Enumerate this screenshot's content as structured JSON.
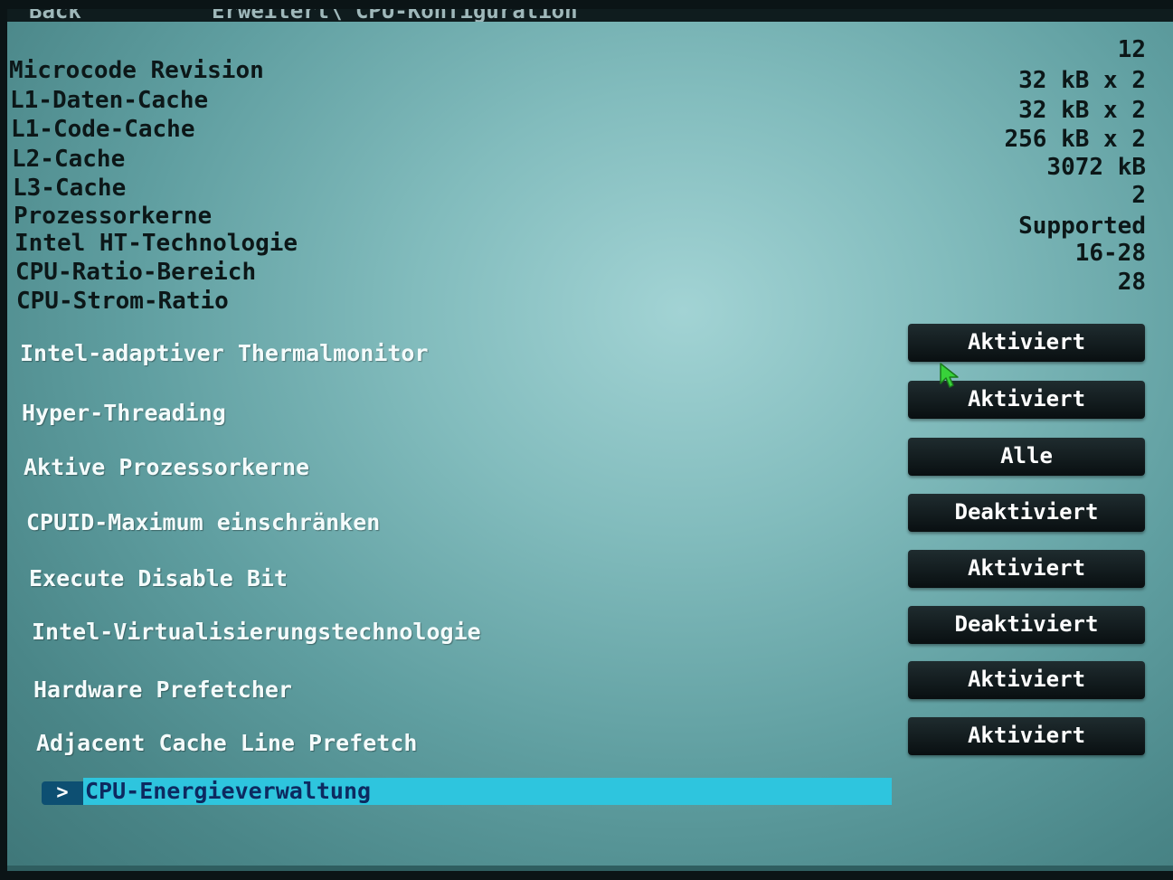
{
  "header": {
    "back_label": "Back",
    "breadcrumb": "Erweitert\\ CPU-Konfiguration"
  },
  "info": [
    {
      "label": "",
      "value": "12"
    },
    {
      "label": "Microcode Revision",
      "value": "32 kB x 2"
    },
    {
      "label": "L1-Daten-Cache",
      "value": "32 kB x 2"
    },
    {
      "label": "L1-Code-Cache",
      "value": "256 kB x 2"
    },
    {
      "label": "L2-Cache",
      "value": "3072 kB"
    },
    {
      "label": "L3-Cache",
      "value": "2"
    },
    {
      "label": "Prozessorkerne",
      "value": "Supported"
    },
    {
      "label": "Intel HT-Technologie",
      "value": "16-28"
    },
    {
      "label": "CPU-Ratio-Bereich",
      "value": "28"
    },
    {
      "label": "CPU-Strom-Ratio",
      "value": ""
    }
  ],
  "settings": [
    {
      "label": "Intel-adaptiver Thermalmonitor",
      "value": "Aktiviert"
    },
    {
      "label": "Hyper-Threading",
      "value": "Aktiviert"
    },
    {
      "label": "Aktive Prozessorkerne",
      "value": "Alle"
    },
    {
      "label": "CPUID-Maximum einschränken",
      "value": "Deaktiviert"
    },
    {
      "label": "Execute Disable Bit",
      "value": "Aktiviert"
    },
    {
      "label": "Intel-Virtualisierungstechnologie",
      "value": "Deaktiviert"
    },
    {
      "label": "Hardware Prefetcher",
      "value": "Aktiviert"
    },
    {
      "label": "Adjacent Cache Line Prefetch",
      "value": "Aktiviert"
    }
  ],
  "submenu": {
    "arrow": ">",
    "label": "CPU-Energieverwaltung"
  },
  "colors": {
    "background": "#82bcbd",
    "highlight": "#2ec5de",
    "button": "#0d1416",
    "arrow_box": "#0d4f72",
    "cursor": "#38d23a"
  },
  "icons": {
    "cursor": "mouse-pointer-icon"
  }
}
